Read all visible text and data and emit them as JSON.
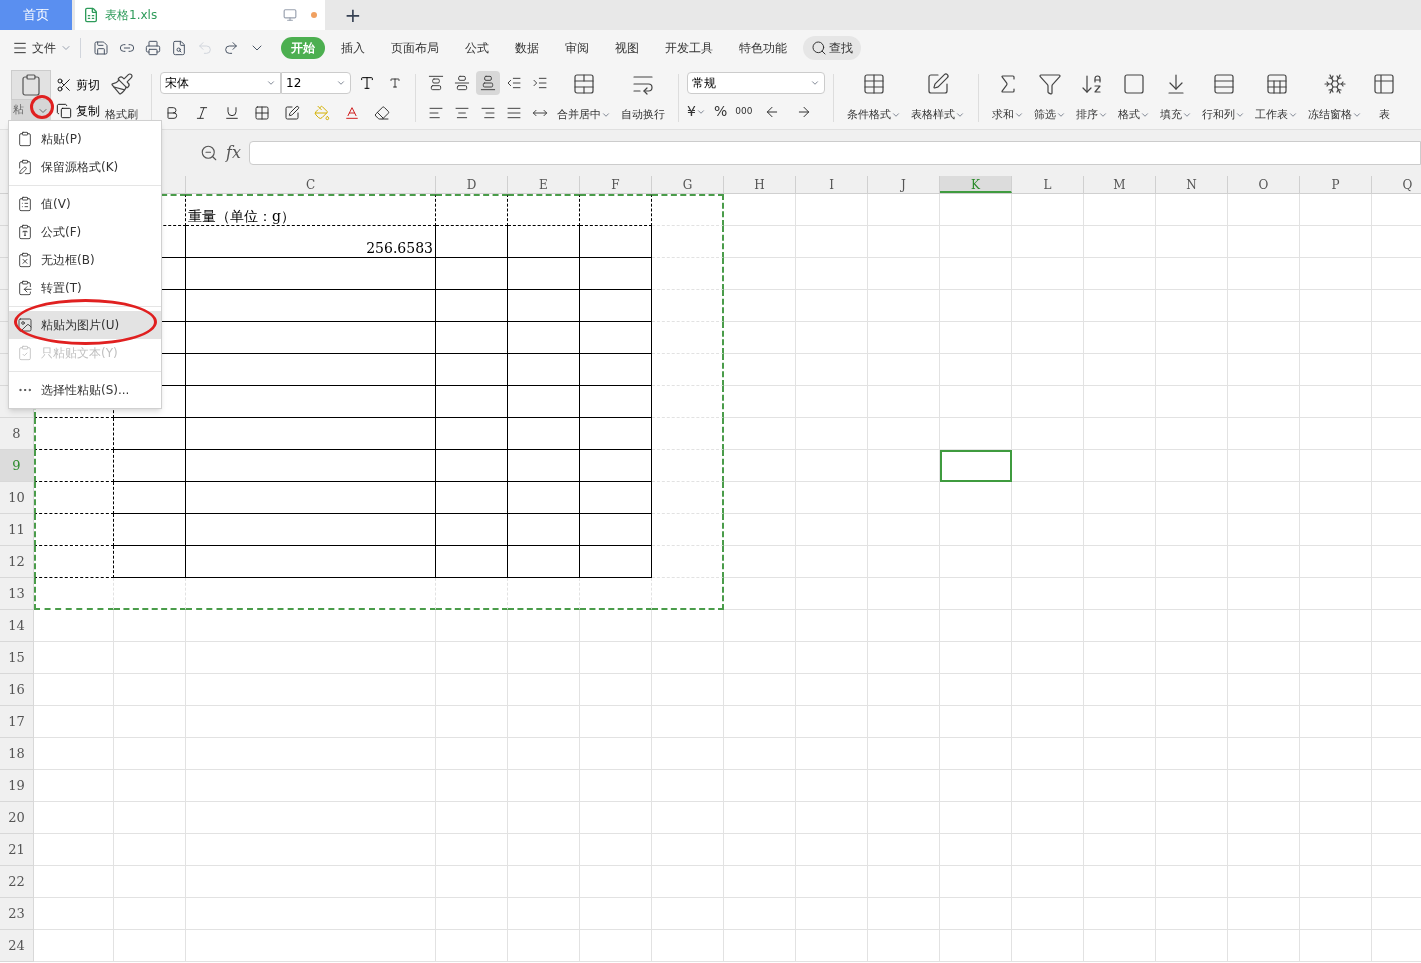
{
  "tabs": [
    {
      "label": "首页",
      "kind": "home",
      "selected": false
    },
    {
      "label": "表格1.xls",
      "kind": "document",
      "selected": true,
      "modified": true
    }
  ],
  "new_tab": "+",
  "menu_bar": {
    "file": "文件",
    "tabs": [
      {
        "label": "开始",
        "selected": true
      },
      {
        "label": "插入",
        "selected": false
      },
      {
        "label": "页面布局",
        "selected": false
      },
      {
        "label": "公式",
        "selected": false
      },
      {
        "label": "数据",
        "selected": false
      },
      {
        "label": "审阅",
        "selected": false
      },
      {
        "label": "视图",
        "selected": false
      },
      {
        "label": "开发工具",
        "selected": false
      },
      {
        "label": "特色功能",
        "selected": false
      }
    ],
    "search": "查找"
  },
  "ribbon": {
    "paste": "粘",
    "cut": "剪切",
    "copy": "复制",
    "format_painter": "格式刷",
    "font": "宋体",
    "font_size": "12",
    "merge": "合并居中",
    "wrap": "自动换行",
    "number_format": "常规",
    "currency": "¥",
    "percent": "%",
    "thousands": "000",
    "tools": [
      {
        "label": "条件格式",
        "dropdown": true
      },
      {
        "label": "表格样式",
        "dropdown": true
      },
      {
        "label": "求和",
        "dropdown": true
      },
      {
        "label": "筛选",
        "dropdown": true
      },
      {
        "label": "排序",
        "dropdown": true
      },
      {
        "label": "格式",
        "dropdown": true
      },
      {
        "label": "填充",
        "dropdown": true
      },
      {
        "label": "行和列",
        "dropdown": true
      },
      {
        "label": "工作表",
        "dropdown": true
      },
      {
        "label": "冻结窗格",
        "dropdown": true
      },
      {
        "label": "表",
        "dropdown": false
      }
    ]
  },
  "formula_bar": {
    "fx": "fx"
  },
  "context_menu": [
    {
      "label": "粘贴(P)",
      "selected": false,
      "disabled": false
    },
    {
      "label": "保留源格式(K)",
      "selected": false,
      "disabled": false
    },
    {
      "label": "值(V)",
      "selected": false,
      "disabled": false
    },
    {
      "label": "公式(F)",
      "selected": false,
      "disabled": false
    },
    {
      "label": "无边框(B)",
      "selected": false,
      "disabled": false
    },
    {
      "label": "转置(T)",
      "selected": false,
      "disabled": false
    },
    {
      "label": "粘贴为图片(U)",
      "selected": true,
      "disabled": false
    },
    {
      "label": "只粘贴文本(Y)",
      "selected": false,
      "disabled": true
    },
    {
      "label": "选择性粘贴(S)...",
      "selected": false,
      "disabled": false
    }
  ],
  "columns": [
    {
      "label": "C",
      "selected": false
    },
    {
      "label": "D",
      "selected": false
    },
    {
      "label": "E",
      "selected": false
    },
    {
      "label": "F",
      "selected": false
    },
    {
      "label": "G",
      "selected": false
    },
    {
      "label": "H",
      "selected": false
    },
    {
      "label": "I",
      "selected": false
    },
    {
      "label": "J",
      "selected": false
    },
    {
      "label": "K",
      "selected": true
    },
    {
      "label": "L",
      "selected": false
    },
    {
      "label": "M",
      "selected": false
    },
    {
      "label": "N",
      "selected": false
    },
    {
      "label": "O",
      "selected": false
    },
    {
      "label": "P",
      "selected": false
    },
    {
      "label": "Q",
      "selected": false
    }
  ],
  "rows": [
    {
      "c": "重量（单位：g）"
    },
    {
      "c": "256.6583"
    },
    {},
    {},
    {},
    {},
    {},
    {
      "header": "8",
      "selected": false
    },
    {
      "header": "9",
      "selected": true
    },
    {
      "header": "10",
      "selected": false
    },
    {
      "header": "11",
      "selected": false
    },
    {
      "header": "12",
      "selected": false
    },
    {
      "header": "13",
      "selected": false
    },
    {
      "header": "14",
      "selected": false
    },
    {
      "header": "15",
      "selected": false
    },
    {
      "header": "16",
      "selected": false
    },
    {
      "header": "17",
      "selected": false
    },
    {
      "header": "18",
      "selected": false
    },
    {
      "header": "19",
      "selected": false
    },
    {
      "header": "20",
      "selected": false
    },
    {
      "header": "21",
      "selected": false
    },
    {
      "header": "22",
      "selected": false
    },
    {
      "header": "23",
      "selected": false
    },
    {
      "header": "24",
      "selected": false
    }
  ]
}
